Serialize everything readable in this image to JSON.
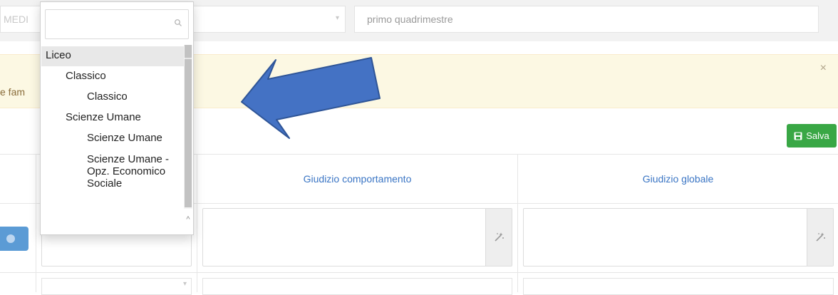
{
  "filters": {
    "left_value_partial": "MEDI",
    "right_value": "primo quadrimestre"
  },
  "alert": {
    "text_partial": "e fam",
    "close_label": "×"
  },
  "toolbar": {
    "save_label": "Salva"
  },
  "table": {
    "columns": [
      "Giudizio comportamento",
      "Giudizio globale"
    ]
  },
  "dropdown": {
    "search_value": "",
    "options": [
      {
        "label": "Liceo",
        "level": 0,
        "highlighted": true
      },
      {
        "label": "Classico",
        "level": 1,
        "highlighted": false
      },
      {
        "label": "Classico",
        "level": 2,
        "highlighted": false
      },
      {
        "label": "Scienze Umane",
        "level": 1,
        "highlighted": false
      },
      {
        "label": "Scienze Umane",
        "level": 2,
        "highlighted": false
      },
      {
        "label": "Scienze Umane - Opz. Economico Sociale",
        "level": 2,
        "highlighted": false
      }
    ]
  },
  "colors": {
    "annotation_arrow": "#4472c4",
    "save_button": "#39a745",
    "alert_background": "#fcf8e3",
    "column_header_text": "#3a75c4"
  },
  "icons": {
    "search": "search-icon",
    "wand": "magic-wand-icon",
    "save": "floppy-disk-icon"
  }
}
